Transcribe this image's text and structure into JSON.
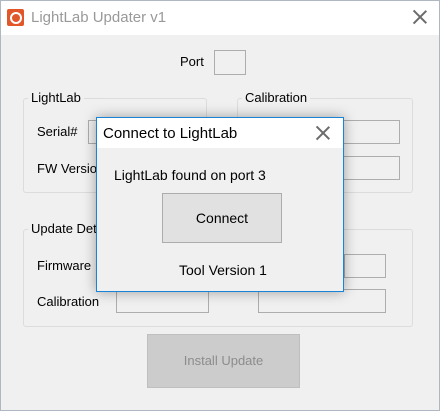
{
  "main_window": {
    "title": "LightLab Updater v1",
    "port_label": "Port",
    "lightlab_group": {
      "title": "LightLab",
      "serial_label": "Serial#",
      "fw_version_label": "FW Version"
    },
    "calibration_group": {
      "title": "Calibration"
    },
    "update_group": {
      "title": "Update Details",
      "firmware_label": "Firmware",
      "calibration_label": "Calibration"
    },
    "install_button": "Install Update"
  },
  "dialog": {
    "title": "Connect to LightLab",
    "message": "LightLab found on port 3",
    "connect_button": "Connect",
    "tool_version": "Tool Version 1"
  }
}
